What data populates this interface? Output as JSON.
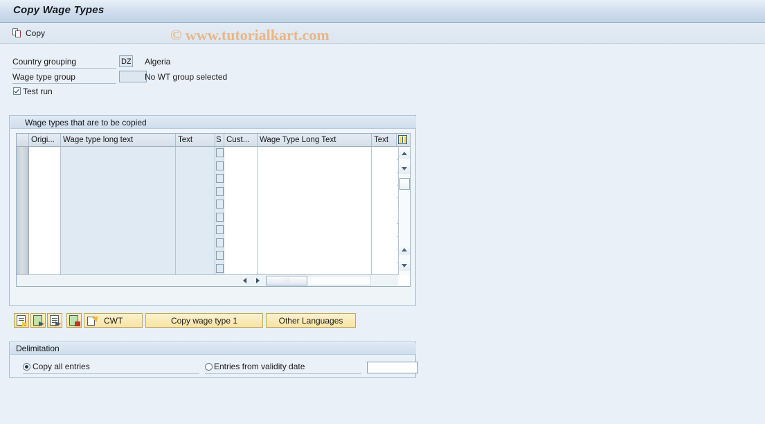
{
  "window": {
    "title": "Copy Wage Types"
  },
  "toolbar": {
    "copy_label": "Copy"
  },
  "watermark": {
    "text": "© www.tutorialkart.com",
    "color": "#e9b787"
  },
  "form": {
    "country_grouping": {
      "label": "Country grouping",
      "value": "DZ",
      "description": "Algeria"
    },
    "wage_type_group": {
      "label": "Wage type group",
      "value": "",
      "description": "No WT group selected"
    },
    "test_run": {
      "label": "Test run",
      "checked": true
    }
  },
  "table": {
    "title": "Wage types that are to be copied",
    "columns": [
      {
        "key": "select",
        "label": ""
      },
      {
        "key": "origin",
        "label": "Origi..."
      },
      {
        "key": "wage_type_long_text",
        "label": "Wage type long text"
      },
      {
        "key": "text",
        "label": "Text"
      },
      {
        "key": "s",
        "label": "S"
      },
      {
        "key": "customer",
        "label": "Cust..."
      },
      {
        "key": "wage_type_long_text_2",
        "label": "Wage Type Long Text"
      },
      {
        "key": "text_2",
        "label": "Text"
      },
      {
        "key": "config",
        "label": ""
      }
    ],
    "config_icon": "table-settings-icon",
    "rows": [
      {
        "origin": "",
        "wage_type_long_text": "",
        "text": "",
        "s": false,
        "customer": "",
        "wage_type_long_text_2": "",
        "text_2": ""
      },
      {
        "origin": "",
        "wage_type_long_text": "",
        "text": "",
        "s": false,
        "customer": "",
        "wage_type_long_text_2": "",
        "text_2": ""
      },
      {
        "origin": "",
        "wage_type_long_text": "",
        "text": "",
        "s": false,
        "customer": "",
        "wage_type_long_text_2": "",
        "text_2": ""
      },
      {
        "origin": "",
        "wage_type_long_text": "",
        "text": "",
        "s": false,
        "customer": "",
        "wage_type_long_text_2": "",
        "text_2": ""
      },
      {
        "origin": "",
        "wage_type_long_text": "",
        "text": "",
        "s": false,
        "customer": "",
        "wage_type_long_text_2": "",
        "text_2": ""
      },
      {
        "origin": "",
        "wage_type_long_text": "",
        "text": "",
        "s": false,
        "customer": "",
        "wage_type_long_text_2": "",
        "text_2": ""
      },
      {
        "origin": "",
        "wage_type_long_text": "",
        "text": "",
        "s": false,
        "customer": "",
        "wage_type_long_text_2": "",
        "text_2": ""
      },
      {
        "origin": "",
        "wage_type_long_text": "",
        "text": "",
        "s": false,
        "customer": "",
        "wage_type_long_text_2": "",
        "text_2": ""
      },
      {
        "origin": "",
        "wage_type_long_text": "",
        "text": "",
        "s": false,
        "customer": "",
        "wage_type_long_text_2": "",
        "text_2": ""
      },
      {
        "origin": "",
        "wage_type_long_text": "",
        "text": "",
        "s": false,
        "customer": "",
        "wage_type_long_text_2": "",
        "text_2": ""
      }
    ]
  },
  "actions": {
    "icon_buttons": [
      {
        "name": "insert-entry-button"
      },
      {
        "name": "copy-entry-button"
      },
      {
        "name": "new-entry-button"
      },
      {
        "name": "delete-entry-button"
      }
    ],
    "cwt_label": "CWT",
    "copy_wage_type_label": "Copy wage type 1",
    "other_languages_label": "Other Languages"
  },
  "delimitation": {
    "title": "Delimitation",
    "copy_all": {
      "label": "Copy all entries",
      "selected": true
    },
    "from_date": {
      "label": "Entries from validity date",
      "selected": false,
      "value": ""
    }
  }
}
